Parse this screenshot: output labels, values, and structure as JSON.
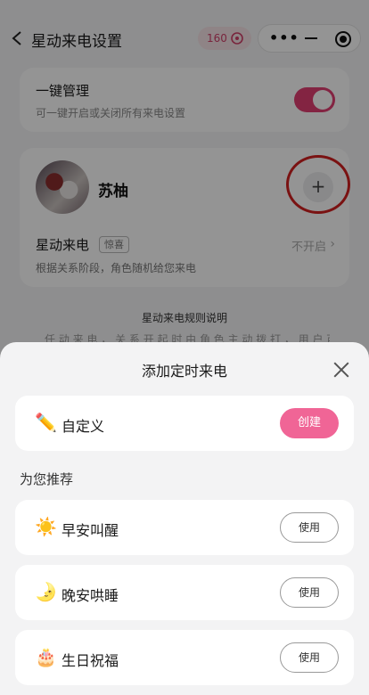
{
  "header": {
    "back_icon": "chevron-left-icon",
    "title": "星动来电设置",
    "badge_count": "160",
    "badge_icon": "flower-icon"
  },
  "one_key": {
    "title": "一键管理",
    "subtitle": "可一键开启或关闭所有来电设置",
    "toggle_on": true
  },
  "contact": {
    "name": "苏柚",
    "add_label": "+",
    "row_label": "星动来电",
    "tag": "惊喜",
    "status": "不开启",
    "chevron": "›",
    "description": "根据关系阶段，角色随机给您来电"
  },
  "rules": {
    "title": "星动来电规则说明",
    "partial_line": "任 动 来 电 ， 关 系 开 起 时 由 角 色 主 动 拨 打 ， 用 户 可 选 择 开 启 时 角 色"
  },
  "sheet": {
    "title": "添加定时来电",
    "close_icon": "close-icon",
    "custom": {
      "icon": "✏️",
      "label": "自定义",
      "button": "创建"
    },
    "section_title": "为您推荐",
    "recommendations": [
      {
        "icon": "☀️",
        "label": "早安叫醒",
        "button": "使用"
      },
      {
        "icon": "🌛",
        "label": "晚安哄睡",
        "button": "使用"
      },
      {
        "icon": "🎂",
        "label": "生日祝福",
        "button": "使用"
      }
    ]
  },
  "colors": {
    "accent": "#e23f72",
    "create_button": "#f06596",
    "highlight_circle": "#d21f1f"
  }
}
